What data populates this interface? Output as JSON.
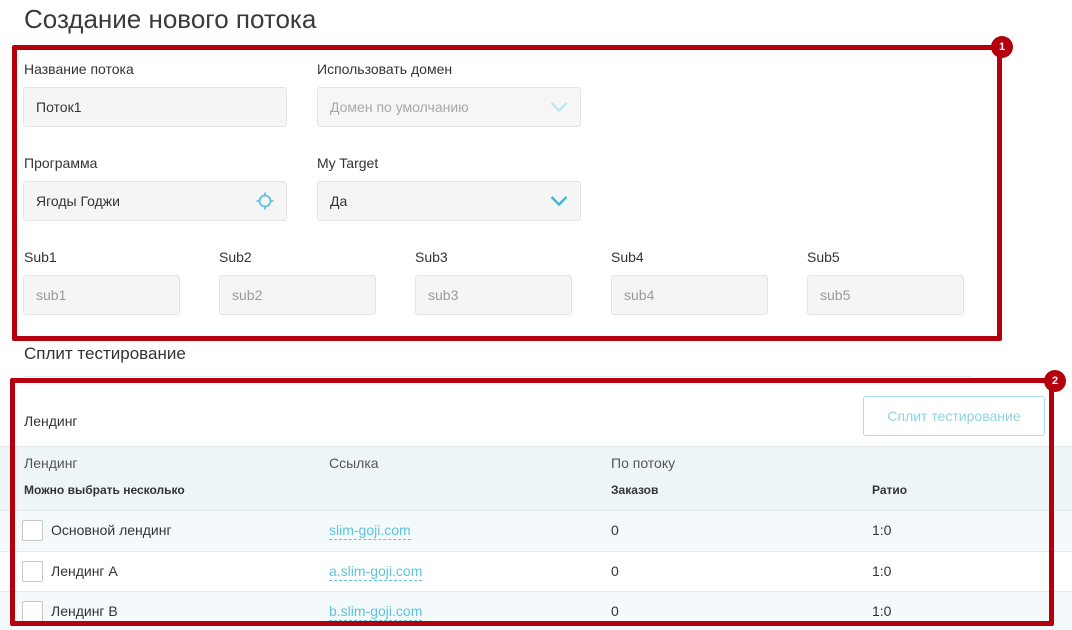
{
  "page": {
    "title": "Создание нового потока"
  },
  "form": {
    "stream_name": {
      "label": "Название потока",
      "value": "Поток1"
    },
    "domain": {
      "label": "Использовать домен",
      "value": "Домен по умолчанию"
    },
    "program": {
      "label": "Программа",
      "value": "Ягоды Годжи"
    },
    "mytarget": {
      "label": "My Target",
      "value": "Да"
    },
    "subs": [
      {
        "label": "Sub1",
        "placeholder": "sub1"
      },
      {
        "label": "Sub2",
        "placeholder": "sub2"
      },
      {
        "label": "Sub3",
        "placeholder": "sub3"
      },
      {
        "label": "Sub4",
        "placeholder": "sub4"
      },
      {
        "label": "Sub5",
        "placeholder": "sub5"
      }
    ]
  },
  "annotations": [
    {
      "label": "1"
    },
    {
      "label": "2"
    }
  ],
  "split": {
    "section_title": "Сплит тестирование",
    "landing_label": "Лендинг",
    "button_label": "Сплит тестирование",
    "columns": {
      "landing": "Лендинг",
      "landing_sub": "Можно выбрать несколько",
      "link": "Ссылка",
      "by_stream": "По потоку",
      "orders": "Заказов",
      "ratio": "Ратио"
    },
    "rows": [
      {
        "name": "Основной лендинг",
        "link": "slim-goji.com",
        "orders": "0",
        "ratio": "1:0"
      },
      {
        "name": "Лендинг А",
        "link": "a.slim-goji.com",
        "orders": "0",
        "ratio": "1:0"
      },
      {
        "name": "Лендинг В",
        "link": "b.slim-goji.com",
        "orders": "0",
        "ratio": "1:0"
      }
    ]
  },
  "colors": {
    "accent": "#5cc4dc",
    "annotation": "#b3000c"
  }
}
